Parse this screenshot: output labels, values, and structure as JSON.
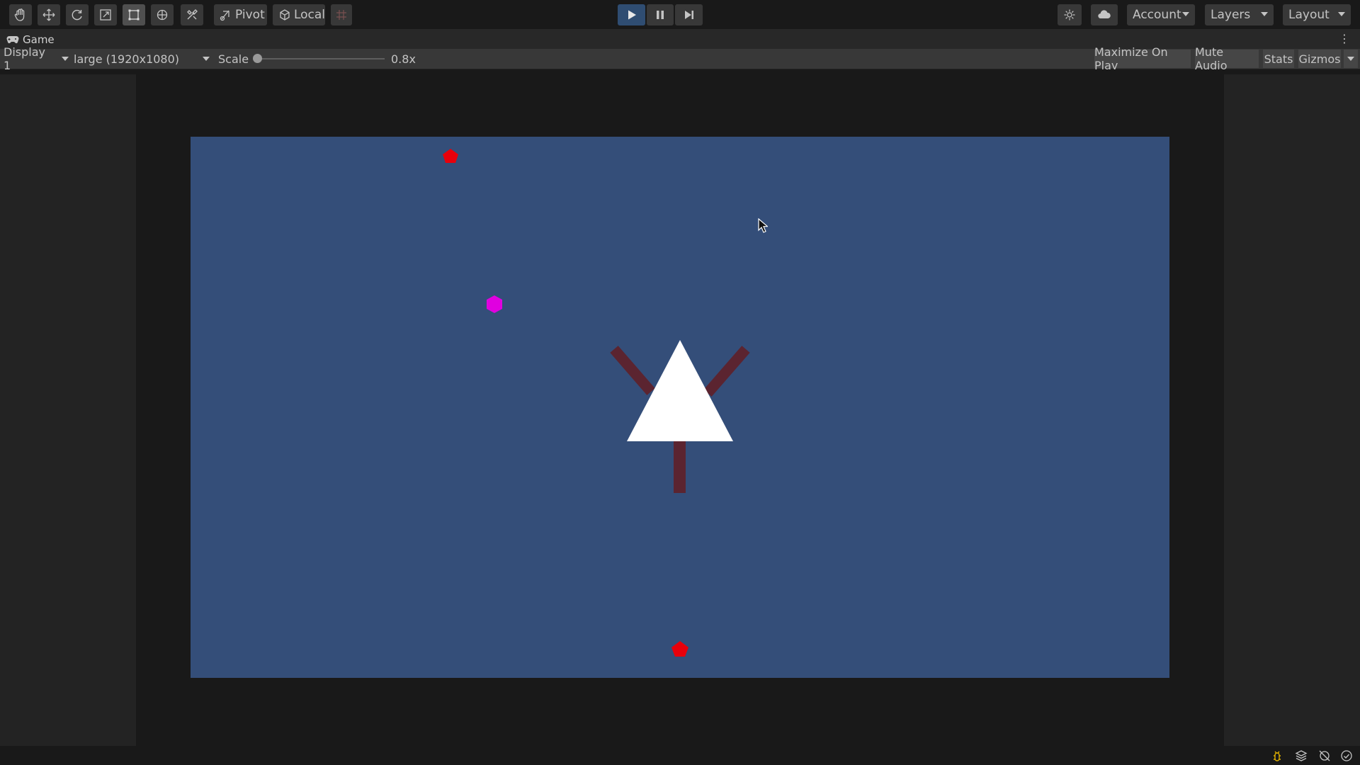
{
  "toolbar": {
    "tools": [
      {
        "icon": "hand-tool-icon"
      },
      {
        "icon": "move-tool-icon"
      },
      {
        "icon": "rotate-tool-icon"
      },
      {
        "icon": "scale-tool-icon"
      },
      {
        "icon": "rect-tool-icon"
      },
      {
        "icon": "transform-tool-icon"
      },
      {
        "icon": "custom-tool-icon"
      }
    ],
    "pivot_label": "Pivot",
    "local_label": "Local",
    "account_label": "Account",
    "layers_label": "Layers",
    "layout_label": "Layout"
  },
  "tab": {
    "title": "Game"
  },
  "controls": {
    "display": "Display 1",
    "resolution": "large (1920x1080)",
    "scale_label": "Scale",
    "scale_value": "0.8x",
    "scale_fraction": 0.0,
    "maximize_label": "Maximize On Play",
    "mute_label": "Mute Audio",
    "stats_label": "Stats",
    "gizmos_label": "Gizmos"
  },
  "colors": {
    "canvas": "#344e79",
    "enemy_red": "#e8000b",
    "pickup_magenta": "#e000e0",
    "player": "#ffffff",
    "player_arms": "#5b2430",
    "play_active": "#2f4d72"
  },
  "game": {
    "player": "white triangle",
    "objects": [
      "red-pentagon",
      "magenta-hexagon",
      "red-pentagon"
    ]
  }
}
